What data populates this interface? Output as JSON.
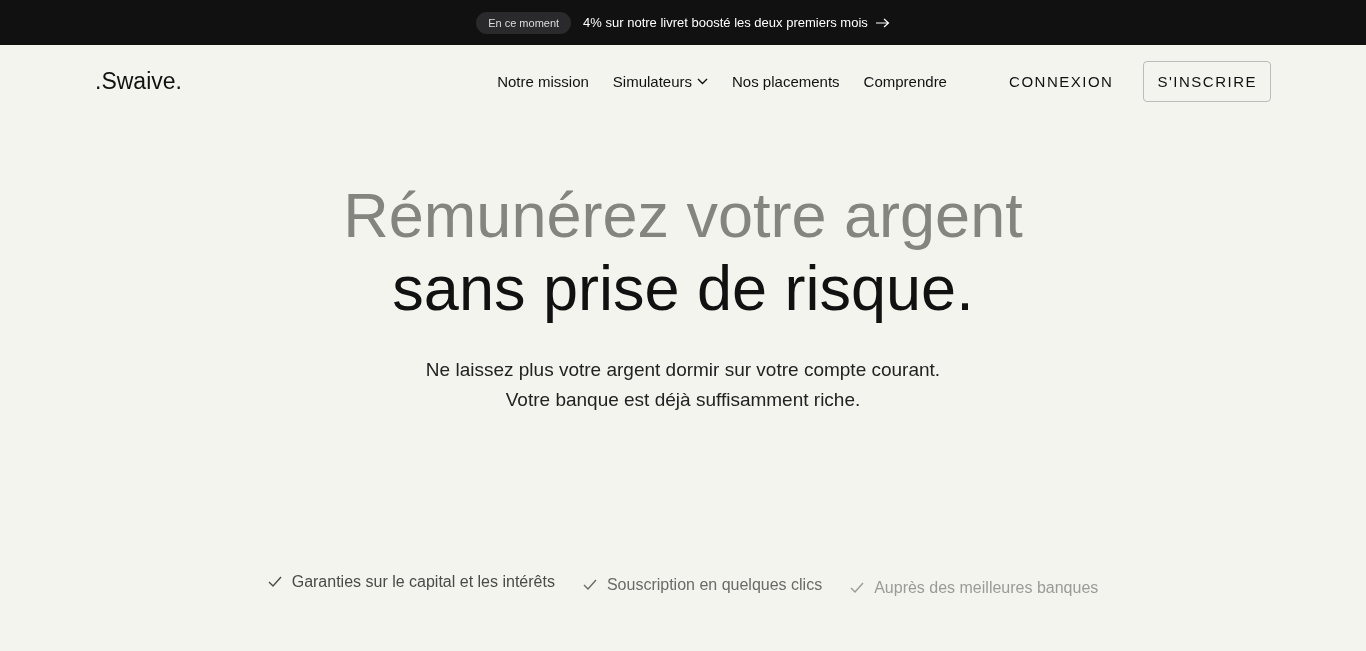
{
  "announcement": {
    "badge": "En ce moment",
    "text": "4% sur notre livret boosté les deux premiers mois"
  },
  "header": {
    "logo": ".Swaive.",
    "nav": [
      {
        "label": "Notre mission",
        "dropdown": false
      },
      {
        "label": "Simulateurs",
        "dropdown": true
      },
      {
        "label": "Nos placements",
        "dropdown": false
      },
      {
        "label": "Comprendre",
        "dropdown": false
      }
    ],
    "login": "CONNEXION",
    "signup": "S'INSCRIRE"
  },
  "hero": {
    "title_line_1": "Rémunérez votre argent",
    "title_line_2": "sans prise de risque.",
    "subtitle_line_1": "Ne laissez plus votre argent dormir sur votre compte courant.",
    "subtitle_line_2": "Votre banque est déjà suffisamment riche."
  },
  "features": [
    {
      "label": "Garanties sur le capital et les intérêts",
      "color": "#4a4a46"
    },
    {
      "label": "Souscription en quelques clics",
      "color": "#6a6a66"
    },
    {
      "label": "Auprès des meilleures banques",
      "color": "#9a9a96"
    }
  ]
}
